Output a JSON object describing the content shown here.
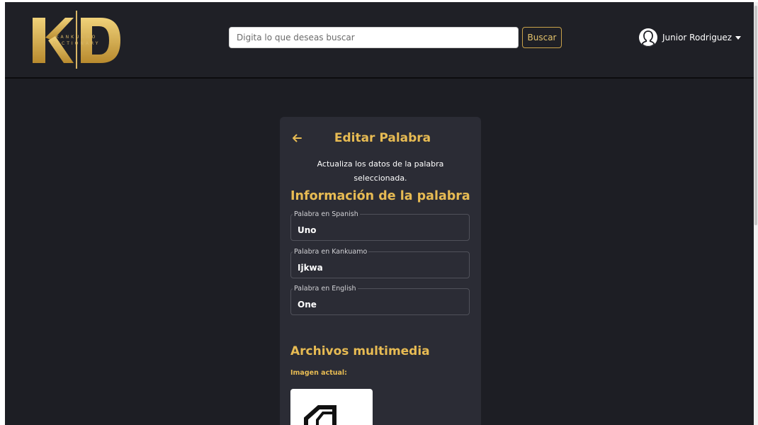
{
  "brand": {
    "logo_letters": "KD",
    "logo_line1": "KANKUAMO",
    "logo_line2": "DICTIONARY",
    "accent_color": "#e7bb53"
  },
  "search": {
    "placeholder": "Digita lo que deseas buscar",
    "button_label": "Buscar"
  },
  "user": {
    "name": "Junior Rodriguez",
    "avatar_icon": "user-avatar-icon",
    "menu_icon": "caret-down-icon"
  },
  "card": {
    "back_icon": "arrow-left-icon",
    "title": "Editar Palabra",
    "subtitle": "Actualiza los datos de la palabra seleccionada.",
    "info_section_title": "Información de la palabra",
    "fields": [
      {
        "label": "Palabra en Spanish",
        "value": "Uno"
      },
      {
        "label": "Palabra en Kankuamo",
        "value": "Ijkwa"
      },
      {
        "label": "Palabra en English",
        "value": "One"
      }
    ],
    "media_section_title": "Archivos multimedia",
    "current_image_label": "Imagen actual:",
    "image_icon": "word-image-icon"
  }
}
